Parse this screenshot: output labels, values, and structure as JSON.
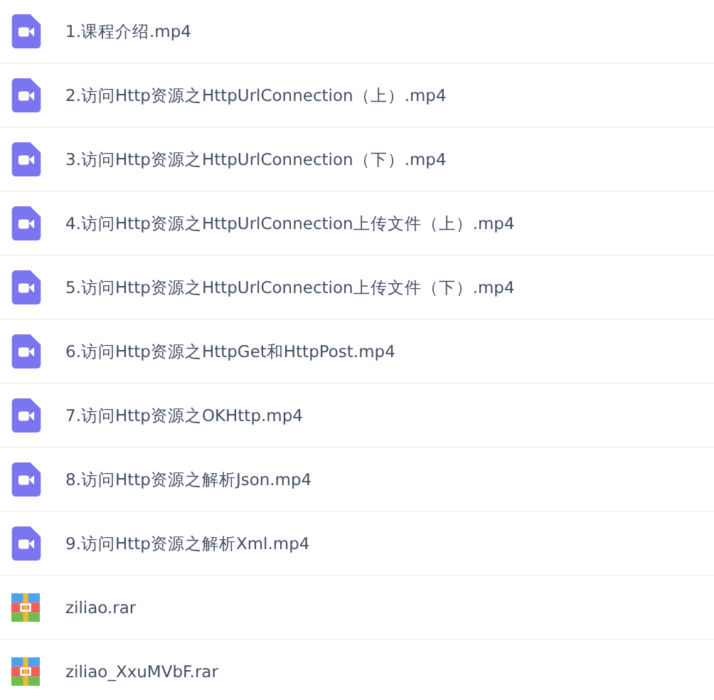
{
  "files": [
    {
      "kind": "video",
      "name": "1.课程介绍.mp4"
    },
    {
      "kind": "video",
      "name": "2.访问Http资源之HttpUrlConnection（上）.mp4"
    },
    {
      "kind": "video",
      "name": "3.访问Http资源之HttpUrlConnection（下）.mp4"
    },
    {
      "kind": "video",
      "name": "4.访问Http资源之HttpUrlConnection上传文件（上）.mp4"
    },
    {
      "kind": "video",
      "name": "5.访问Http资源之HttpUrlConnection上传文件（下）.mp4"
    },
    {
      "kind": "video",
      "name": "6.访问Http资源之HttpGet和HttpPost.mp4"
    },
    {
      "kind": "video",
      "name": "7.访问Http资源之OKHttp.mp4"
    },
    {
      "kind": "video",
      "name": "8.访问Http资源之解析Json.mp4"
    },
    {
      "kind": "video",
      "name": "9.访问Http资源之解析Xml.mp4"
    },
    {
      "kind": "archive",
      "name": "ziliao.rar"
    },
    {
      "kind": "archive",
      "name": "ziliao_XxuMVbF.rar"
    }
  ]
}
